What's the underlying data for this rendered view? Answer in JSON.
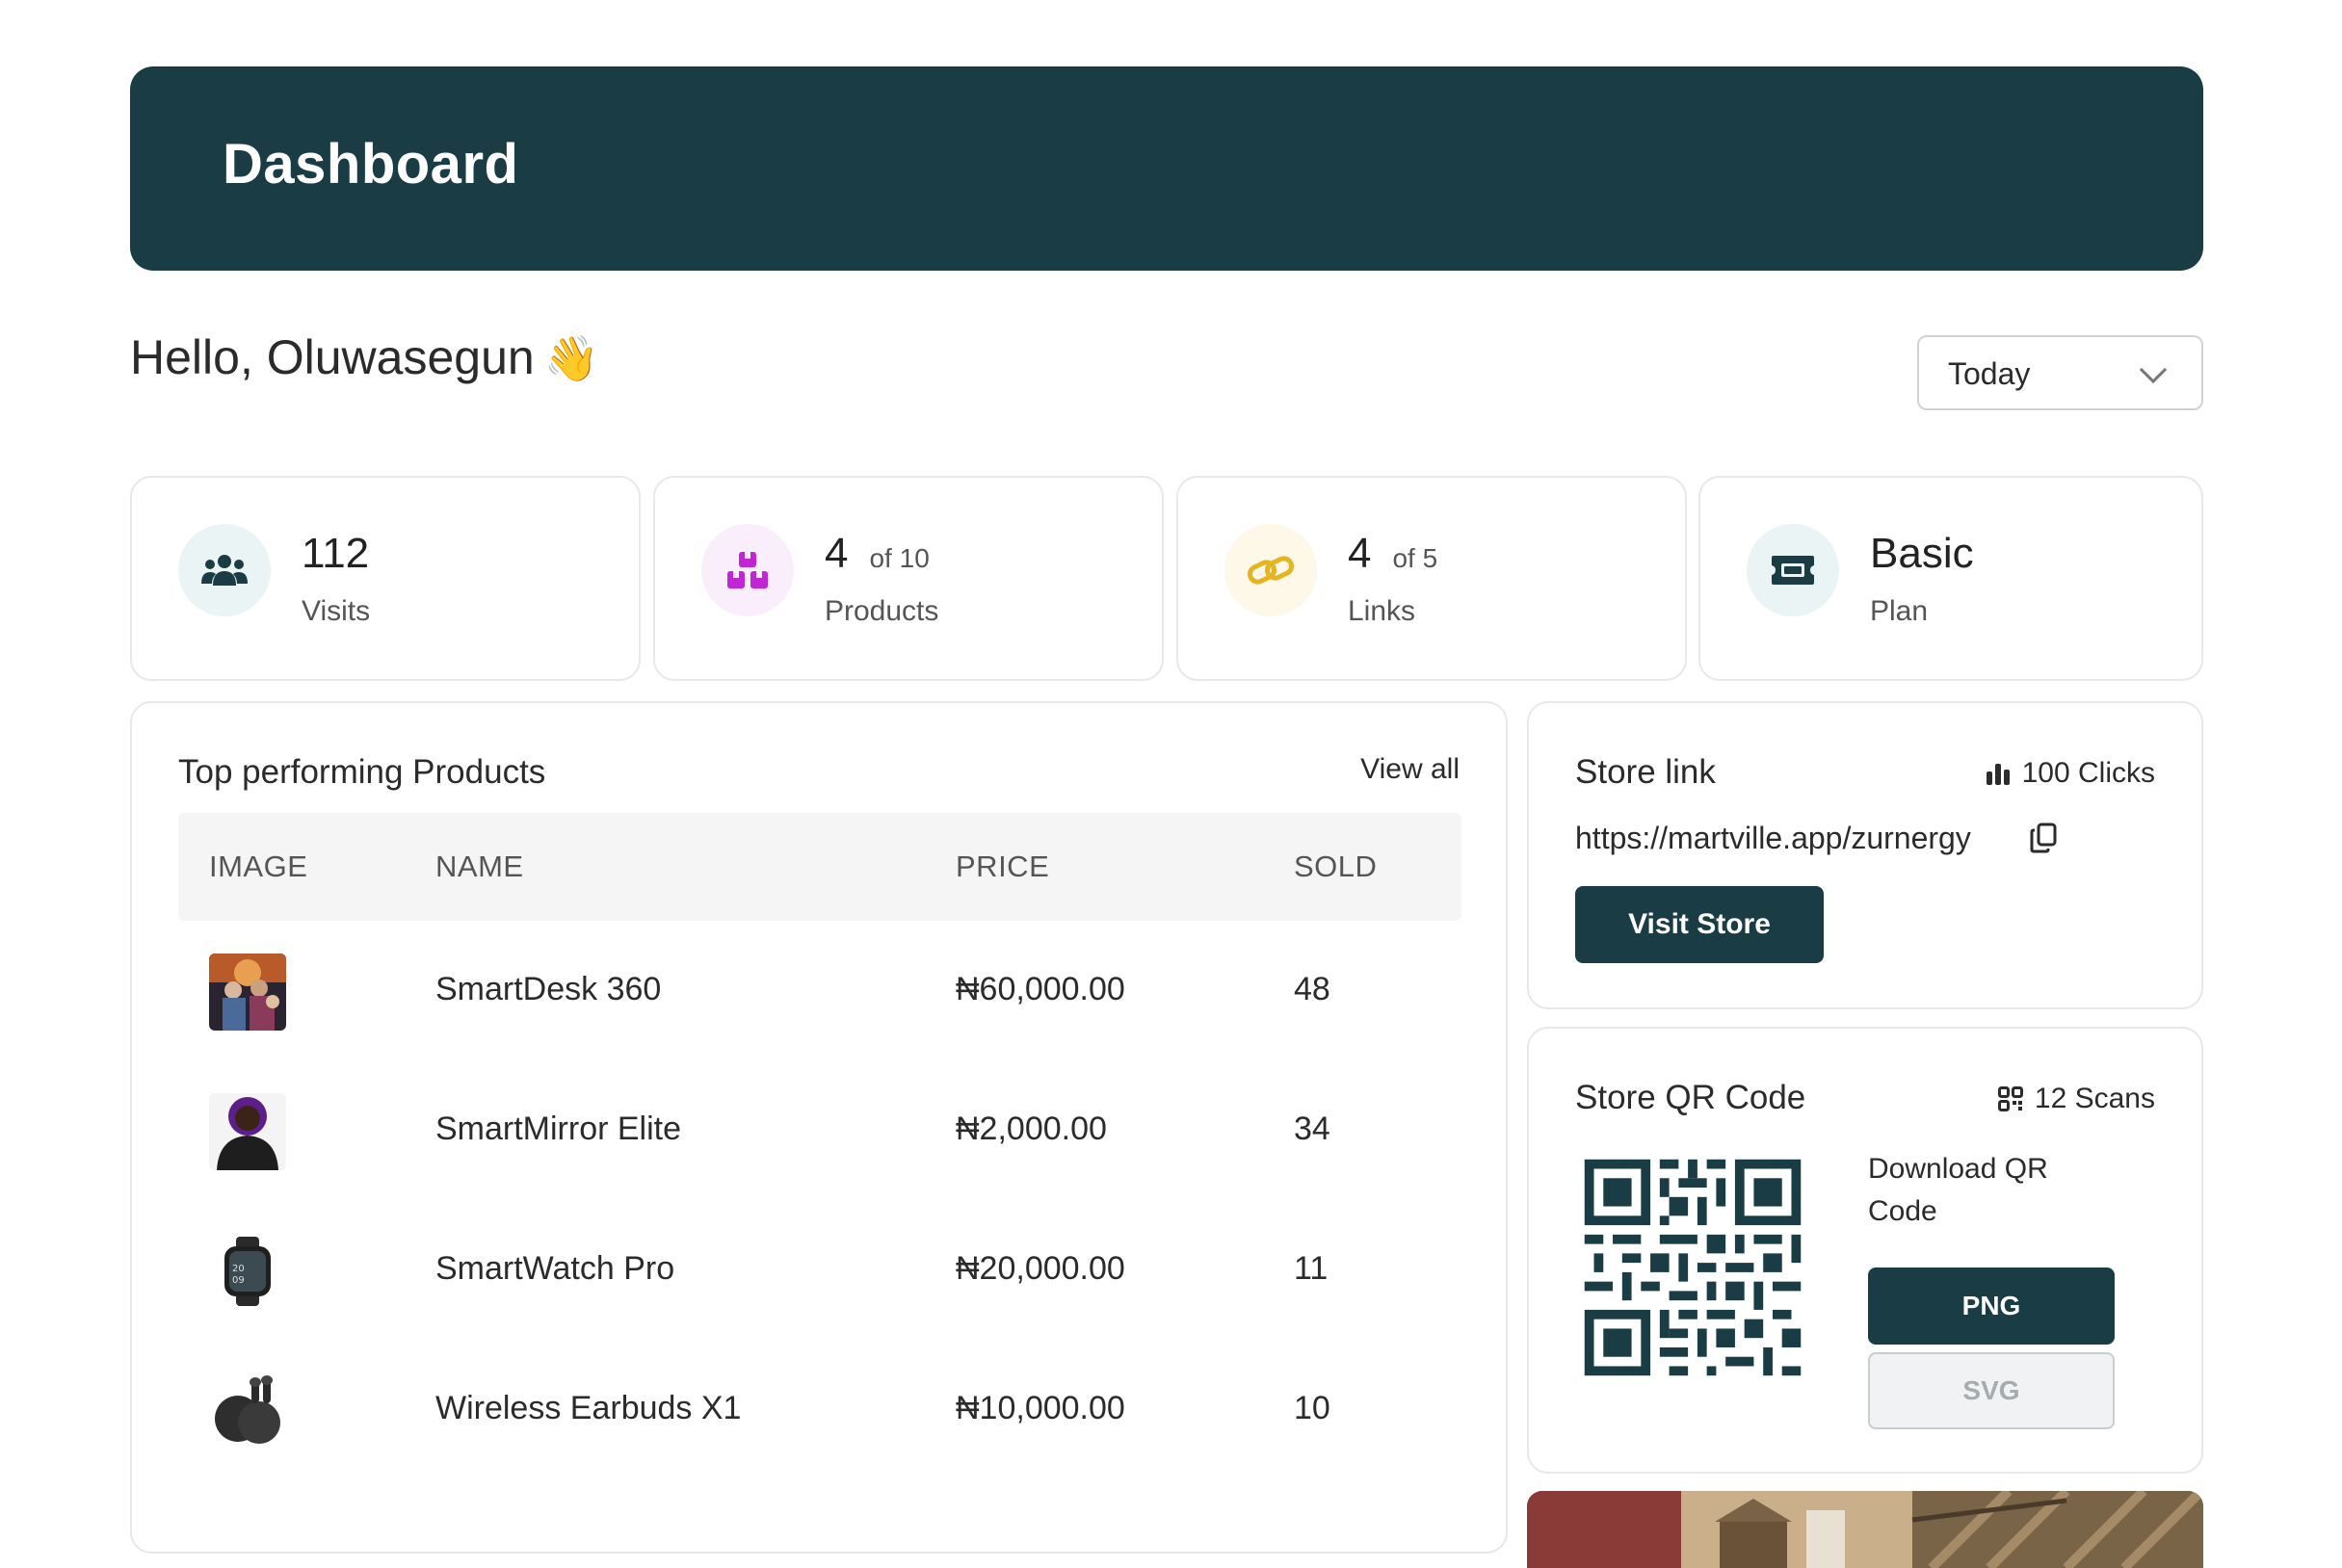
{
  "header": {
    "title": "Dashboard"
  },
  "greeting": {
    "text": "Hello, Oluwasegun",
    "emoji": "👋"
  },
  "period_select": {
    "selected": "Today"
  },
  "stats": [
    {
      "icon": "users-icon",
      "value": "112",
      "suffix": "",
      "caption": "Visits",
      "color": "#193c45",
      "bg": "#eaf4f4"
    },
    {
      "icon": "boxes-icon",
      "value": "4",
      "suffix": "of 10",
      "caption": "Products",
      "color": "#c026d3",
      "bg": "#fbeefc"
    },
    {
      "icon": "link-icon",
      "value": "4",
      "suffix": "of 5",
      "caption": "Links",
      "color": "#e6b422",
      "bg": "#fdf8e8"
    },
    {
      "icon": "ticket-icon",
      "value": "Basic",
      "suffix": "",
      "caption": "Plan",
      "color": "#193c45",
      "bg": "#eaf4f4"
    }
  ],
  "products": {
    "title": "Top performing Products",
    "view_all": "View all",
    "columns": [
      "IMAGE",
      "NAME",
      "PRICE",
      "SOLD"
    ],
    "rows": [
      {
        "name": "SmartDesk 360",
        "price": "₦60,000.00",
        "sold": "48",
        "image": "concert-photo"
      },
      {
        "name": "SmartMirror Elite",
        "price": "₦2,000.00",
        "sold": "34",
        "image": "person-photo"
      },
      {
        "name": "SmartWatch Pro",
        "price": "₦20,000.00",
        "sold": "11",
        "image": "smartwatch-photo"
      },
      {
        "name": "Wireless Earbuds X1",
        "price": "₦10,000.00",
        "sold": "10",
        "image": "earbuds-photo"
      }
    ]
  },
  "store_link": {
    "title": "Store link",
    "clicks": "100 Clicks",
    "url": "https://martville.app/zurnergy",
    "button": "Visit Store"
  },
  "store_qr": {
    "title": "Store QR Code",
    "scans": "12 Scans",
    "download_label": "Download QR Code",
    "png_button": "PNG",
    "svg_button": "SVG"
  },
  "colors": {
    "brand": "#193c45",
    "border": "#e6e8ea"
  }
}
